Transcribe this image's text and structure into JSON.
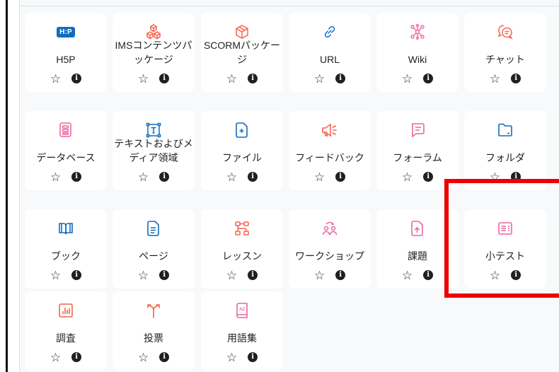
{
  "colors": {
    "communication": "#f7634d",
    "content": "#0f6cbf",
    "collaboration": "#eb66a2",
    "assessment": "#c70f9d",
    "administration": "#399be2",
    "interactive": "#f7634d",
    "highlight": "#ee0000"
  },
  "activities": [
    {
      "id": "h5p",
      "label": "H5P",
      "icon": "h5p-icon",
      "badge": "H:P"
    },
    {
      "id": "ims",
      "label": "IMSコンテンツパッケージ",
      "icon": "cubes-icon"
    },
    {
      "id": "scorm",
      "label": "SCORMパッケージ",
      "icon": "box-icon"
    },
    {
      "id": "url",
      "label": "URL",
      "icon": "link-icon"
    },
    {
      "id": "wiki",
      "label": "Wiki",
      "icon": "network-icon"
    },
    {
      "id": "chat",
      "label": "チャット",
      "icon": "chat-icon"
    },
    {
      "id": "database",
      "label": "データベース",
      "icon": "database-icon"
    },
    {
      "id": "textmedia",
      "label": "テキストおよびメディア領域",
      "icon": "text-area-icon"
    },
    {
      "id": "file",
      "label": "ファイル",
      "icon": "file-plus-icon"
    },
    {
      "id": "feedback",
      "label": "フィードバック",
      "icon": "megaphone-icon"
    },
    {
      "id": "forum",
      "label": "フォーラム",
      "icon": "forum-icon"
    },
    {
      "id": "folder",
      "label": "フォルダ",
      "icon": "folder-icon"
    },
    {
      "id": "book",
      "label": "ブック",
      "icon": "book-icon"
    },
    {
      "id": "page",
      "label": "ページ",
      "icon": "page-icon"
    },
    {
      "id": "lesson",
      "label": "レッスン",
      "icon": "lesson-icon"
    },
    {
      "id": "workshop",
      "label": "ワークショップ",
      "icon": "workshop-icon"
    },
    {
      "id": "assign",
      "label": "課題",
      "icon": "assignment-icon"
    },
    {
      "id": "quiz",
      "label": "小テスト",
      "icon": "quiz-icon"
    },
    {
      "id": "survey",
      "label": "調査",
      "icon": "survey-icon"
    },
    {
      "id": "choice",
      "label": "投票",
      "icon": "choice-icon"
    },
    {
      "id": "glossary",
      "label": "用語集",
      "icon": "glossary-icon"
    }
  ],
  "actions": {
    "star_glyph": "☆",
    "info_glyph": "i"
  },
  "highlighted_activity": "quiz"
}
